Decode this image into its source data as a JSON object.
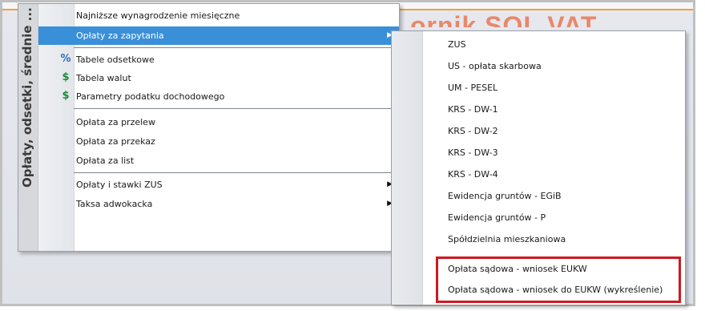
{
  "background": {
    "title_fragment": "ornik SOL VAT"
  },
  "main_menu": {
    "vertical_title": "Opłaty, odsetki, średnie ...",
    "items": [
      {
        "label": "Najniższe wynagrodzenie miesięczne",
        "submenu": false
      },
      {
        "label": "Opłaty za zapytania",
        "submenu": true,
        "selected": true
      },
      {
        "label": "Tabele odsetkowe",
        "icon": "percent-icon",
        "submenu": false
      },
      {
        "label": "Tabela walut",
        "icon": "dollar-icon",
        "submenu": false
      },
      {
        "label": "Parametry podatku dochodowego",
        "icon": "money-bag-icon",
        "submenu": false
      },
      {
        "label": "Opłata za przelew",
        "submenu": false
      },
      {
        "label": "Opłata za przekaz",
        "submenu": false
      },
      {
        "label": "Opłata za list",
        "submenu": false
      },
      {
        "label": "Opłaty i stawki ZUS",
        "submenu": true
      },
      {
        "label": "Taksa adwokacka",
        "submenu": true
      }
    ],
    "icons": {
      "percent": "%",
      "dollar": "$",
      "bag": "$"
    }
  },
  "submenu": {
    "parent": "Opłaty za zapytania",
    "items": [
      "ZUS",
      "US - opłata skarbowa",
      "UM - PESEL",
      "KRS - DW-1",
      "KRS - DW-2",
      "KRS - DW-3",
      "KRS - DW-4",
      "Ewidencja gruntów - EGiB",
      "Ewidencja gruntów - P",
      "Spółdzielnia mieszkaniowa",
      "Opłata sądowa - wniosek EUKW",
      "Opłata sądowa - wniosek do EUKW (wykreślenie)"
    ],
    "highlighted_items": [
      10,
      11
    ],
    "highlight_color": "#d0181f"
  },
  "colors": {
    "selection": "#3a8fd9",
    "accent": "#f0a040"
  }
}
